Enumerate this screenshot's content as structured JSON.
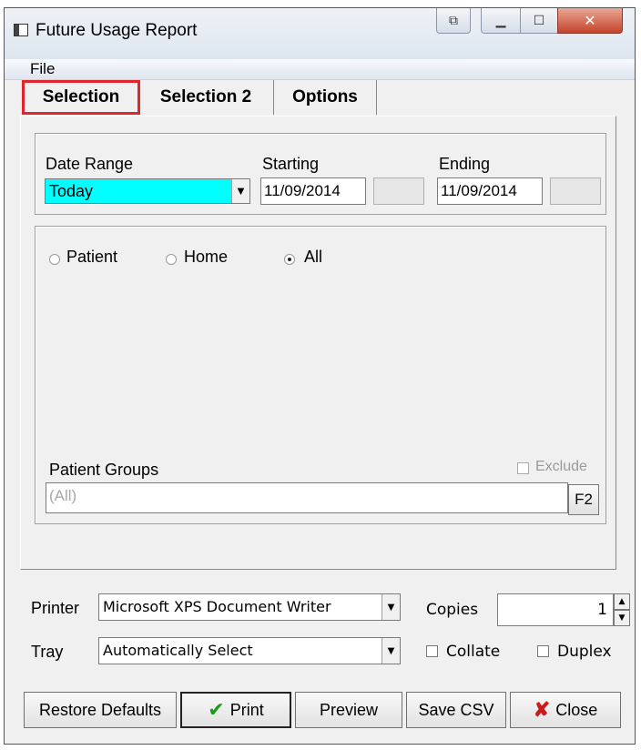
{
  "window": {
    "title": "Future Usage Report"
  },
  "menu": {
    "file": "File"
  },
  "tabs": [
    "Selection",
    "Selection 2",
    "Options"
  ],
  "selection": {
    "date_range_label": "Date Range",
    "date_range_value": "Today",
    "starting_label": "Starting",
    "starting_value": "11/09/2014",
    "ending_label": "Ending",
    "ending_value": "11/09/2014",
    "radios": [
      {
        "label": "Patient",
        "selected": false
      },
      {
        "label": "Home",
        "selected": false
      },
      {
        "label": "All",
        "selected": true
      }
    ],
    "patient_groups_label": "Patient Groups",
    "exclude_label": "Exclude",
    "patient_groups_value": "(All)",
    "f2_label": "F2"
  },
  "printing": {
    "printer_label": "Printer",
    "printer_value": "Microsoft XPS Document Writer",
    "tray_label": "Tray",
    "tray_value": "Automatically Select",
    "copies_label": "Copies",
    "copies_value": "1",
    "collate_label": "Collate",
    "duplex_label": "Duplex"
  },
  "buttons": {
    "restore_defaults": "Restore Defaults",
    "print": "Print",
    "preview": "Preview",
    "save_csv": "Save CSV",
    "close": "Close"
  },
  "colors": {
    "date_range_highlight": "#00ffff",
    "tab_highlight_border": "#e0262c",
    "print_check": "#1c9a1c",
    "close_x": "#cc1a1a"
  }
}
